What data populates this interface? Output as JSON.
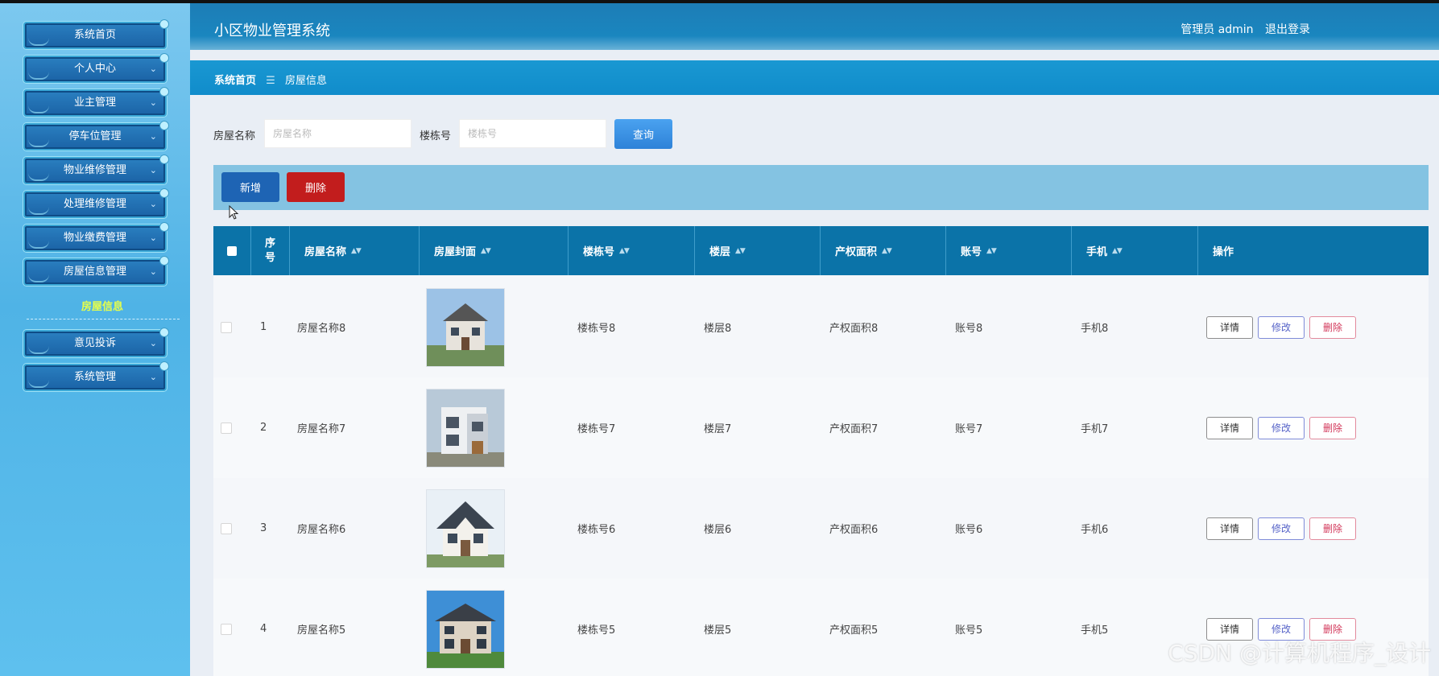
{
  "app": {
    "title": "小区物业管理系统"
  },
  "header": {
    "user_label": "管理员 admin",
    "logout_label": "退出登录"
  },
  "sidebar": {
    "items": [
      {
        "label": "系统首页",
        "has_chevron": false
      },
      {
        "label": "个人中心",
        "has_chevron": true
      },
      {
        "label": "业主管理",
        "has_chevron": true
      },
      {
        "label": "停车位管理",
        "has_chevron": true
      },
      {
        "label": "物业维修管理",
        "has_chevron": true
      },
      {
        "label": "处理维修管理",
        "has_chevron": true
      },
      {
        "label": "物业缴费管理",
        "has_chevron": true
      },
      {
        "label": "房屋信息管理",
        "has_chevron": true
      },
      {
        "label": "意见投诉",
        "has_chevron": true
      },
      {
        "label": "系统管理",
        "has_chevron": true
      }
    ],
    "active_sub_item": "房屋信息"
  },
  "breadcrumb": {
    "home": "系统首页",
    "separator": "☰",
    "current": "房屋信息"
  },
  "search": {
    "name_label": "房屋名称",
    "name_placeholder": "房屋名称",
    "building_label": "楼栋号",
    "building_placeholder": "楼栋号",
    "query_button": "查询"
  },
  "actions": {
    "add_label": "新增",
    "delete_label": "删除"
  },
  "table": {
    "columns": [
      "序号",
      "房屋名称",
      "房屋封面",
      "楼栋号",
      "楼层",
      "产权面积",
      "账号",
      "手机",
      "操作"
    ],
    "rows": [
      {
        "seq": "1",
        "name": "房屋名称8",
        "building": "楼栋号8",
        "floor": "楼层8",
        "area": "产权面积8",
        "account": "账号8",
        "phone": "手机8"
      },
      {
        "seq": "2",
        "name": "房屋名称7",
        "building": "楼栋号7",
        "floor": "楼层7",
        "area": "产权面积7",
        "account": "账号7",
        "phone": "手机7"
      },
      {
        "seq": "3",
        "name": "房屋名称6",
        "building": "楼栋号6",
        "floor": "楼层6",
        "area": "产权面积6",
        "account": "账号6",
        "phone": "手机6"
      },
      {
        "seq": "4",
        "name": "房屋名称5",
        "building": "楼栋号5",
        "floor": "楼层5",
        "area": "产权面积5",
        "account": "账号5",
        "phone": "手机5"
      }
    ],
    "op_detail": "详情",
    "op_edit": "修改",
    "op_delete": "删除"
  },
  "watermark": "CSDN @计算机程序_设计",
  "colors": {
    "header": "#1a86bf",
    "table_header": "#0b73a8",
    "add_button": "#1e64b4",
    "delete_button": "#c21d1d",
    "active_submenu": "#e7ff4a"
  }
}
